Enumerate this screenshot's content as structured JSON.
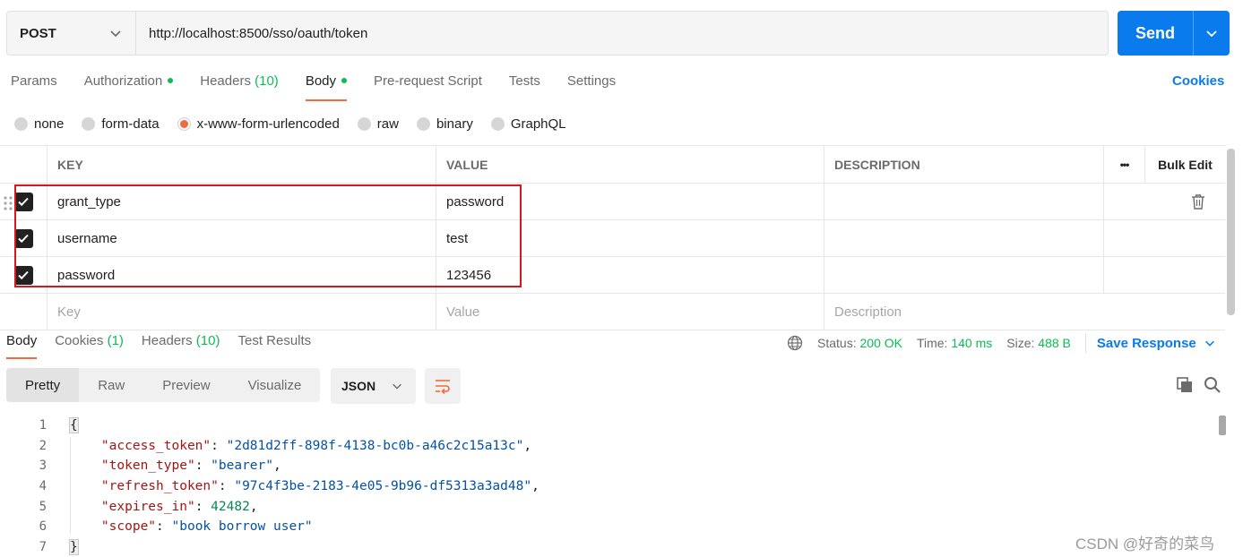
{
  "request": {
    "method": "POST",
    "url": "http://localhost:8500/sso/oauth/token",
    "send_label": "Send"
  },
  "request_tabs": [
    {
      "label": "Params",
      "count": "",
      "dot": false,
      "active": false
    },
    {
      "label": "Authorization",
      "count": "",
      "dot": true,
      "active": false
    },
    {
      "label": "Headers",
      "count": "(10)",
      "dot": false,
      "active": false
    },
    {
      "label": "Body",
      "count": "",
      "dot": true,
      "active": true
    },
    {
      "label": "Pre-request Script",
      "count": "",
      "dot": false,
      "active": false
    },
    {
      "label": "Tests",
      "count": "",
      "dot": false,
      "active": false
    },
    {
      "label": "Settings",
      "count": "",
      "dot": false,
      "active": false
    }
  ],
  "cookies_link": "Cookies",
  "body_types": [
    {
      "label": "none",
      "selected": false
    },
    {
      "label": "form-data",
      "selected": false
    },
    {
      "label": "x-www-form-urlencoded",
      "selected": true
    },
    {
      "label": "raw",
      "selected": false
    },
    {
      "label": "binary",
      "selected": false
    },
    {
      "label": "GraphQL",
      "selected": false
    }
  ],
  "params_table": {
    "headers": {
      "key": "KEY",
      "value": "VALUE",
      "description": "DESCRIPTION",
      "more": "•••",
      "bulk_edit": "Bulk Edit"
    },
    "rows": [
      {
        "key": "grant_type",
        "value": "password",
        "description": "",
        "checked": true
      },
      {
        "key": "username",
        "value": "test",
        "description": "",
        "checked": true
      },
      {
        "key": "password",
        "value": "123456",
        "description": "",
        "checked": true
      }
    ],
    "placeholders": {
      "key": "Key",
      "value": "Value",
      "description": "Description"
    }
  },
  "response_tabs": [
    {
      "label": "Body",
      "count": "",
      "active": true
    },
    {
      "label": "Cookies",
      "count": "(1)",
      "active": false
    },
    {
      "label": "Headers",
      "count": "(10)",
      "active": false
    },
    {
      "label": "Test Results",
      "count": "",
      "active": false
    }
  ],
  "response_status": {
    "status_label": "Status:",
    "status_value": "200 OK",
    "time_label": "Time:",
    "time_value": "140 ms",
    "size_label": "Size:",
    "size_value": "488 B",
    "save_label": "Save Response"
  },
  "view_modes": [
    {
      "label": "Pretty",
      "active": true
    },
    {
      "label": "Raw",
      "active": false
    },
    {
      "label": "Preview",
      "active": false
    },
    {
      "label": "Visualize",
      "active": false
    }
  ],
  "format": "JSON",
  "code_lines": [
    {
      "num": "1",
      "open": "{"
    },
    {
      "num": "2",
      "key": "\"access_token\"",
      "value": "\"2d81d2ff-898f-4138-bc0b-a46c2c15a13c\"",
      "type": "string",
      "comma": true
    },
    {
      "num": "3",
      "key": "\"token_type\"",
      "value": "\"bearer\"",
      "type": "string",
      "comma": true
    },
    {
      "num": "4",
      "key": "\"refresh_token\"",
      "value": "\"97c4f3be-2183-4e05-9b96-df5313a3ad48\"",
      "type": "string",
      "comma": true
    },
    {
      "num": "5",
      "key": "\"expires_in\"",
      "value": "42482",
      "type": "number",
      "comma": true
    },
    {
      "num": "6",
      "key": "\"scope\"",
      "value": "\"book borrow user\"",
      "type": "string",
      "comma": false
    },
    {
      "num": "7",
      "open": "}"
    }
  ],
  "watermark": "CSDN @好奇的菜鸟",
  "colors": {
    "accent": "#f26b3a",
    "primary": "#097bed",
    "success": "#0cbb52",
    "highlight": "#d9161b"
  }
}
